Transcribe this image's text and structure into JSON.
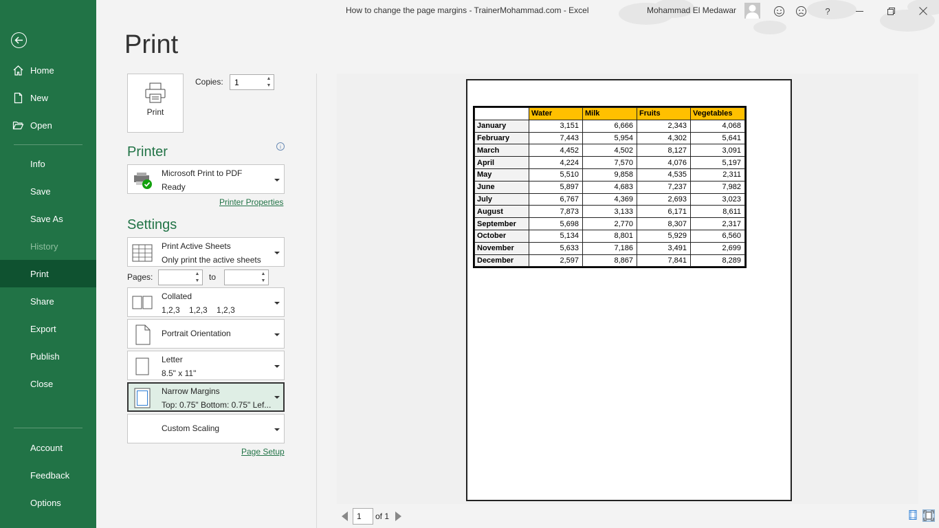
{
  "window": {
    "title": "How to change the page margins - TrainerMohammad.com  -  Excel",
    "user": "Mohammad El Medawar",
    "help": "?"
  },
  "sidebar": {
    "items": [
      {
        "label": "Home"
      },
      {
        "label": "New"
      },
      {
        "label": "Open"
      },
      {
        "label": "Info"
      },
      {
        "label": "Save"
      },
      {
        "label": "Save As"
      },
      {
        "label": "History"
      },
      {
        "label": "Print"
      },
      {
        "label": "Share"
      },
      {
        "label": "Export"
      },
      {
        "label": "Publish"
      },
      {
        "label": "Close"
      },
      {
        "label": "Account"
      },
      {
        "label": "Feedback"
      },
      {
        "label": "Options"
      }
    ],
    "active": "Print",
    "disabled": "History"
  },
  "print": {
    "heading": "Print",
    "button_label": "Print",
    "copies_label": "Copies:",
    "copies_value": "1",
    "printer_heading": "Printer",
    "printer_name": "Microsoft Print to PDF",
    "printer_status": "Ready",
    "printer_properties": "Printer Properties",
    "settings_heading": "Settings",
    "what": {
      "title": "Print Active Sheets",
      "sub": "Only print the active sheets"
    },
    "pages_label": "Pages:",
    "pages_from": "",
    "to_label": "to",
    "pages_to": "",
    "collation": {
      "title": "Collated",
      "sub": "1,2,3    1,2,3    1,2,3"
    },
    "orientation": "Portrait Orientation",
    "paper": {
      "title": "Letter",
      "sub": "8.5\" x 11\""
    },
    "margins": {
      "title": "Narrow Margins",
      "sub": "Top: 0.75\" Bottom: 0.75\" Lef..."
    },
    "scaling": "Custom Scaling",
    "page_setup": "Page Setup"
  },
  "preview": {
    "page_current": "1",
    "page_total": "of 1",
    "table": {
      "headers": [
        "",
        "Water",
        "Milk",
        "Fruits",
        "Vegetables"
      ],
      "rows": [
        [
          "January",
          "3,151",
          "6,666",
          "2,343",
          "4,068"
        ],
        [
          "February",
          "7,443",
          "5,954",
          "4,302",
          "5,641"
        ],
        [
          "March",
          "4,452",
          "4,502",
          "8,127",
          "3,091"
        ],
        [
          "April",
          "4,224",
          "7,570",
          "4,076",
          "5,197"
        ],
        [
          "May",
          "5,510",
          "9,858",
          "4,535",
          "2,311"
        ],
        [
          "June",
          "5,897",
          "4,683",
          "7,237",
          "7,982"
        ],
        [
          "July",
          "6,767",
          "4,369",
          "2,693",
          "3,023"
        ],
        [
          "August",
          "7,873",
          "3,133",
          "6,171",
          "8,611"
        ],
        [
          "September",
          "5,698",
          "2,770",
          "8,307",
          "2,317"
        ],
        [
          "October",
          "5,134",
          "8,801",
          "5,929",
          "6,560"
        ],
        [
          "November",
          "5,633",
          "7,186",
          "3,491",
          "2,699"
        ],
        [
          "December",
          "2,597",
          "8,867",
          "7,841",
          "8,289"
        ]
      ]
    }
  },
  "colors": {
    "accent": "#217346",
    "active_nav": "#0f5230",
    "header_fill": "#ffc000"
  }
}
